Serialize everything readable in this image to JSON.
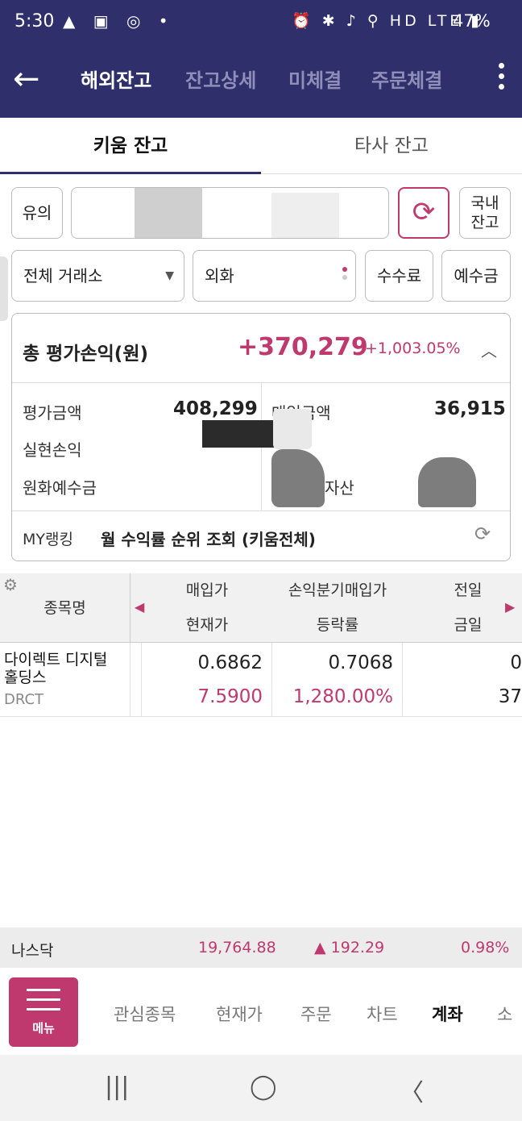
{
  "status_bar": {
    "time": "5:30",
    "left_icons": "▲ ▣ ◎ •",
    "right_icons": "⏰ ✱ ♪ ⚲ HD LTE ▮",
    "battery": "47%"
  },
  "app_bar": {
    "tabs": [
      "해외잔고",
      "잔고상세",
      "미체결",
      "주문체결"
    ],
    "active_tab": 0
  },
  "sub_tabs": [
    "키움 잔고",
    "타사 잔고"
  ],
  "controls": {
    "notice_label": "유의",
    "domestic_line1": "국내",
    "domestic_line2": "잔고",
    "exchange_select": "전체 거래소",
    "currency_select": "외화",
    "fee_label": "수수료",
    "deposit_label": "예수금"
  },
  "summary": {
    "total_label": "총 평가손익(원)",
    "total_amount": "+370,279",
    "total_pct": "+1,003.05%",
    "eval_label": "평가금액",
    "eval_value": "408,299",
    "buy_label": "매입금액",
    "buy_value": "36,915",
    "realized_label": "실현손익",
    "krw_deposit_label": "원화예수금",
    "asset_label": "자산",
    "rank_label": "MY랭킹",
    "rank_text": "월 수익률 순위 조회 (키움전체)"
  },
  "table": {
    "header": {
      "name": "종목명",
      "col1_top": "매입가",
      "col1_bottom": "현재가",
      "col2_top": "손익분기매입가",
      "col2_bottom": "등락률",
      "col3_top": "전일",
      "col3_bottom": "금일"
    },
    "rows": [
      {
        "name": "다이렉트 디지털 홀딩스",
        "code": "DRCT",
        "buy_price": "0.6862",
        "current_price": "7.5900",
        "breakeven": "0.7068",
        "change_rate": "1,280.00%",
        "prev": "0",
        "today": "37"
      }
    ]
  },
  "ticker": {
    "name": "나스닥",
    "value": "19,764.88",
    "change": "▲ 192.29",
    "pct": "0.98%"
  },
  "bottom_nav": {
    "menu_label": "메뉴",
    "items": [
      "관심종목",
      "현재가",
      "주문",
      "차트",
      "계좌",
      "소"
    ],
    "active_item": 4
  },
  "system_nav": [
    "|||",
    "◯",
    "〈"
  ],
  "colors": {
    "header_bg": "#2e2f6b",
    "accent": "#c0396e",
    "table_header_bg": "#f1f1f1"
  }
}
